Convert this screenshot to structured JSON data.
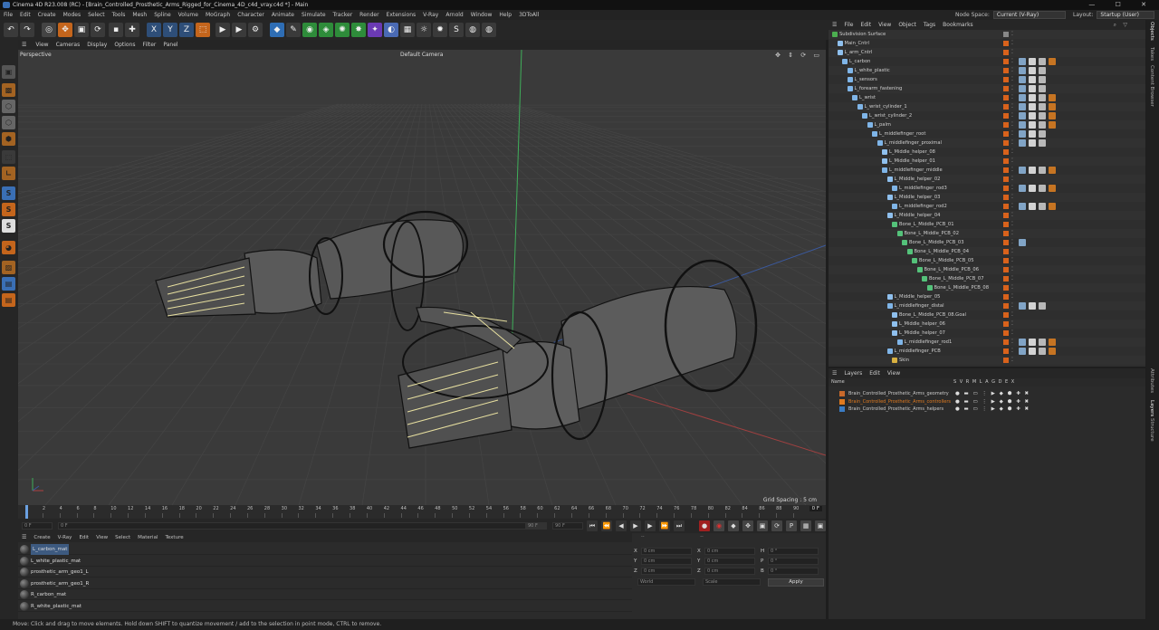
{
  "window": {
    "title": "Cinema 4D R23.008 (RC) - [Brain_Controlled_Prosthetic_Arms_Rigged_for_Cinema_4D_c4d_vray.c4d *] - Main"
  },
  "menubar": {
    "items": [
      "File",
      "Edit",
      "Create",
      "Modes",
      "Select",
      "Tools",
      "Mesh",
      "Spline",
      "Volume",
      "MoGraph",
      "Character",
      "Animate",
      "Simulate",
      "Tracker",
      "Render",
      "Extensions",
      "V-Ray",
      "Arnold",
      "Window",
      "Help",
      "3DToAll"
    ],
    "node_space_label": "Node Space:",
    "node_space_value": "Current (V-Ray)",
    "layout_label": "Layout:",
    "layout_value": "Startup (User)"
  },
  "viewport": {
    "menu": [
      "View",
      "Cameras",
      "Display",
      "Options",
      "Filter",
      "Panel"
    ],
    "name": "Perspective",
    "camera": "Default Camera",
    "grid_spacing": "Grid Spacing : 5 cm"
  },
  "timeline": {
    "ticks": [
      "0",
      "2",
      "4",
      "6",
      "8",
      "10",
      "12",
      "14",
      "16",
      "18",
      "20",
      "22",
      "24",
      "26",
      "28",
      "30",
      "32",
      "34",
      "36",
      "38",
      "40",
      "42",
      "44",
      "46",
      "48",
      "50",
      "52",
      "54",
      "56",
      "58",
      "60",
      "62",
      "64",
      "66",
      "68",
      "70",
      "72",
      "74",
      "76",
      "78",
      "80",
      "82",
      "84",
      "86",
      "88",
      "90"
    ],
    "current_frame": "0 F",
    "start_field": "0 F",
    "start_field2": "0 F",
    "end_field": "90 F",
    "end_field2": "90 F"
  },
  "objects_panel": {
    "menu": [
      "File",
      "Edit",
      "View",
      "Object",
      "Tags",
      "Bookmarks"
    ],
    "rows": [
      {
        "name": "Subdivision Surface",
        "depth": 0,
        "icon": "subdivision-icon",
        "tags": 0
      },
      {
        "name": "Main_Cntrl",
        "depth": 1,
        "icon": "null-icon",
        "tags": 0
      },
      {
        "name": "L_arm_Cntrl",
        "depth": 1,
        "icon": "null-icon",
        "tags": 0
      },
      {
        "name": "L_carbon",
        "depth": 2,
        "icon": "mesh-icon",
        "tags": 4
      },
      {
        "name": "L_white_plastic",
        "depth": 3,
        "icon": "mesh-icon",
        "tags": 3
      },
      {
        "name": "L_sensors",
        "depth": 3,
        "icon": "mesh-icon",
        "tags": 3
      },
      {
        "name": "L_forearm_fastening",
        "depth": 3,
        "icon": "mesh-icon",
        "tags": 3
      },
      {
        "name": "L_wrist",
        "depth": 4,
        "icon": "mesh-icon",
        "tags": 4
      },
      {
        "name": "L_wrist_cylinder_1",
        "depth": 5,
        "icon": "mesh-icon",
        "tags": 4
      },
      {
        "name": "L_wrist_cylinder_2",
        "depth": 6,
        "icon": "mesh-icon",
        "tags": 4
      },
      {
        "name": "L_palm",
        "depth": 7,
        "icon": "mesh-icon",
        "tags": 4
      },
      {
        "name": "L_middlefinger_root",
        "depth": 8,
        "icon": "mesh-icon",
        "tags": 3
      },
      {
        "name": "L_middlefinger_proximal",
        "depth": 9,
        "icon": "mesh-icon",
        "tags": 3
      },
      {
        "name": "L_Middle_helper_08",
        "depth": 10,
        "icon": "null-icon",
        "tags": 0
      },
      {
        "name": "L_Middle_helper_01",
        "depth": 10,
        "icon": "null-icon",
        "tags": 0
      },
      {
        "name": "L_middlefinger_middle",
        "depth": 10,
        "icon": "mesh-icon",
        "tags": 4
      },
      {
        "name": "L_Middle_helper_02",
        "depth": 11,
        "icon": "null-icon",
        "tags": 0
      },
      {
        "name": "L_middlefinger_rod3",
        "depth": 12,
        "icon": "mesh-icon",
        "tags": 4
      },
      {
        "name": "L_Middle_helper_03",
        "depth": 11,
        "icon": "null-icon",
        "tags": 0
      },
      {
        "name": "L_middlefinger_rod2",
        "depth": 12,
        "icon": "mesh-icon",
        "tags": 4
      },
      {
        "name": "L_Middle_helper_04",
        "depth": 11,
        "icon": "null-icon",
        "tags": 0
      },
      {
        "name": "Bone_L_Middle_PCB_01",
        "depth": 12,
        "icon": "bone-icon",
        "tags": 0
      },
      {
        "name": "Bone_L_Middle_PCB_02",
        "depth": 13,
        "icon": "bone-icon",
        "tags": 0
      },
      {
        "name": "Bone_L_Middle_PCB_03",
        "depth": 14,
        "icon": "bone-icon",
        "tags": 1
      },
      {
        "name": "Bone_L_Middle_PCB_04",
        "depth": 15,
        "icon": "bone-icon",
        "tags": 0
      },
      {
        "name": "Bone_L_Middle_PCB_05",
        "depth": 16,
        "icon": "bone-icon",
        "tags": 0
      },
      {
        "name": "Bone_L_Middle_PCB_06",
        "depth": 17,
        "icon": "bone-icon",
        "tags": 0
      },
      {
        "name": "Bone_L_Middle_PCB_07",
        "depth": 18,
        "icon": "bone-icon",
        "tags": 0
      },
      {
        "name": "Bone_L_Middle_PCB_08",
        "depth": 19,
        "icon": "bone-icon",
        "tags": 0
      },
      {
        "name": "L_Middle_helper_05",
        "depth": 11,
        "icon": "null-icon",
        "tags": 0
      },
      {
        "name": "L_middlefinger_distal",
        "depth": 11,
        "icon": "mesh-icon",
        "tags": 3
      },
      {
        "name": "Bone_L_Middle_PCB_08.Goal",
        "depth": 12,
        "icon": "null-icon",
        "tags": 0
      },
      {
        "name": "L_Middle_helper_06",
        "depth": 12,
        "icon": "null-icon",
        "tags": 0
      },
      {
        "name": "L_Middle_helper_07",
        "depth": 12,
        "icon": "null-icon",
        "tags": 0
      },
      {
        "name": "L_middlefinger_rod1",
        "depth": 13,
        "icon": "mesh-icon",
        "tags": 4
      },
      {
        "name": "L_middlefinger_PCB",
        "depth": 11,
        "icon": "mesh-icon",
        "tags": 4
      },
      {
        "name": "Skin",
        "depth": 12,
        "icon": "skin-icon",
        "tags": 0
      }
    ]
  },
  "layers_panel": {
    "menu": [
      "Layers",
      "Edit",
      "View"
    ],
    "col_name": "Name",
    "col_flags": "S V R M L A G D E X",
    "rows": [
      {
        "name": "Brain_Controlled_Prosthetic_Arms_geometry",
        "color": "#c8692b"
      },
      {
        "name": "Brain_Controlled_Prosthetic_Arms_controllers",
        "color": "#e07a1f"
      },
      {
        "name": "Brain_Controlled_Prosthetic_Arms_helpers",
        "color": "#3b7cc4"
      }
    ]
  },
  "side_tabs": [
    "Objects",
    "Takes",
    "Content Browser",
    "Attributes",
    "Layers",
    "Structure"
  ],
  "material_panel": {
    "menu": [
      "Create",
      "V-Ray",
      "Edit",
      "View",
      "Select",
      "Material",
      "Texture"
    ],
    "materials": [
      "L_carbon_mat",
      "L_white_plastic_mat",
      "prosthetic_arm_geo1_L",
      "prosthetic_arm_geo1_R",
      "R_carbon_mat",
      "R_white_plastic_mat"
    ]
  },
  "attributes_panel": {
    "header_left": "--",
    "header_mid": "--",
    "rows": [
      {
        "a": "X",
        "av": "0 cm",
        "b": "X",
        "bv": "0 cm",
        "c": "H",
        "cv": "0 °"
      },
      {
        "a": "Y",
        "av": "0 cm",
        "b": "Y",
        "bv": "0 cm",
        "c": "P",
        "cv": "0 °"
      },
      {
        "a": "Z",
        "av": "0 cm",
        "b": "Z",
        "bv": "0 cm",
        "c": "B",
        "cv": "0 °"
      }
    ],
    "coord_mode": "World",
    "size_mode": "Scale",
    "apply_label": "Apply"
  },
  "status": {
    "text": "Move: Click and drag to move elements. Hold down SHIFT to quantize movement / add to the selection in point mode, CTRL to remove."
  },
  "colors": {
    "accent": "#4a8fd8",
    "orange": "#e07020",
    "selected": "#3d5a80"
  }
}
